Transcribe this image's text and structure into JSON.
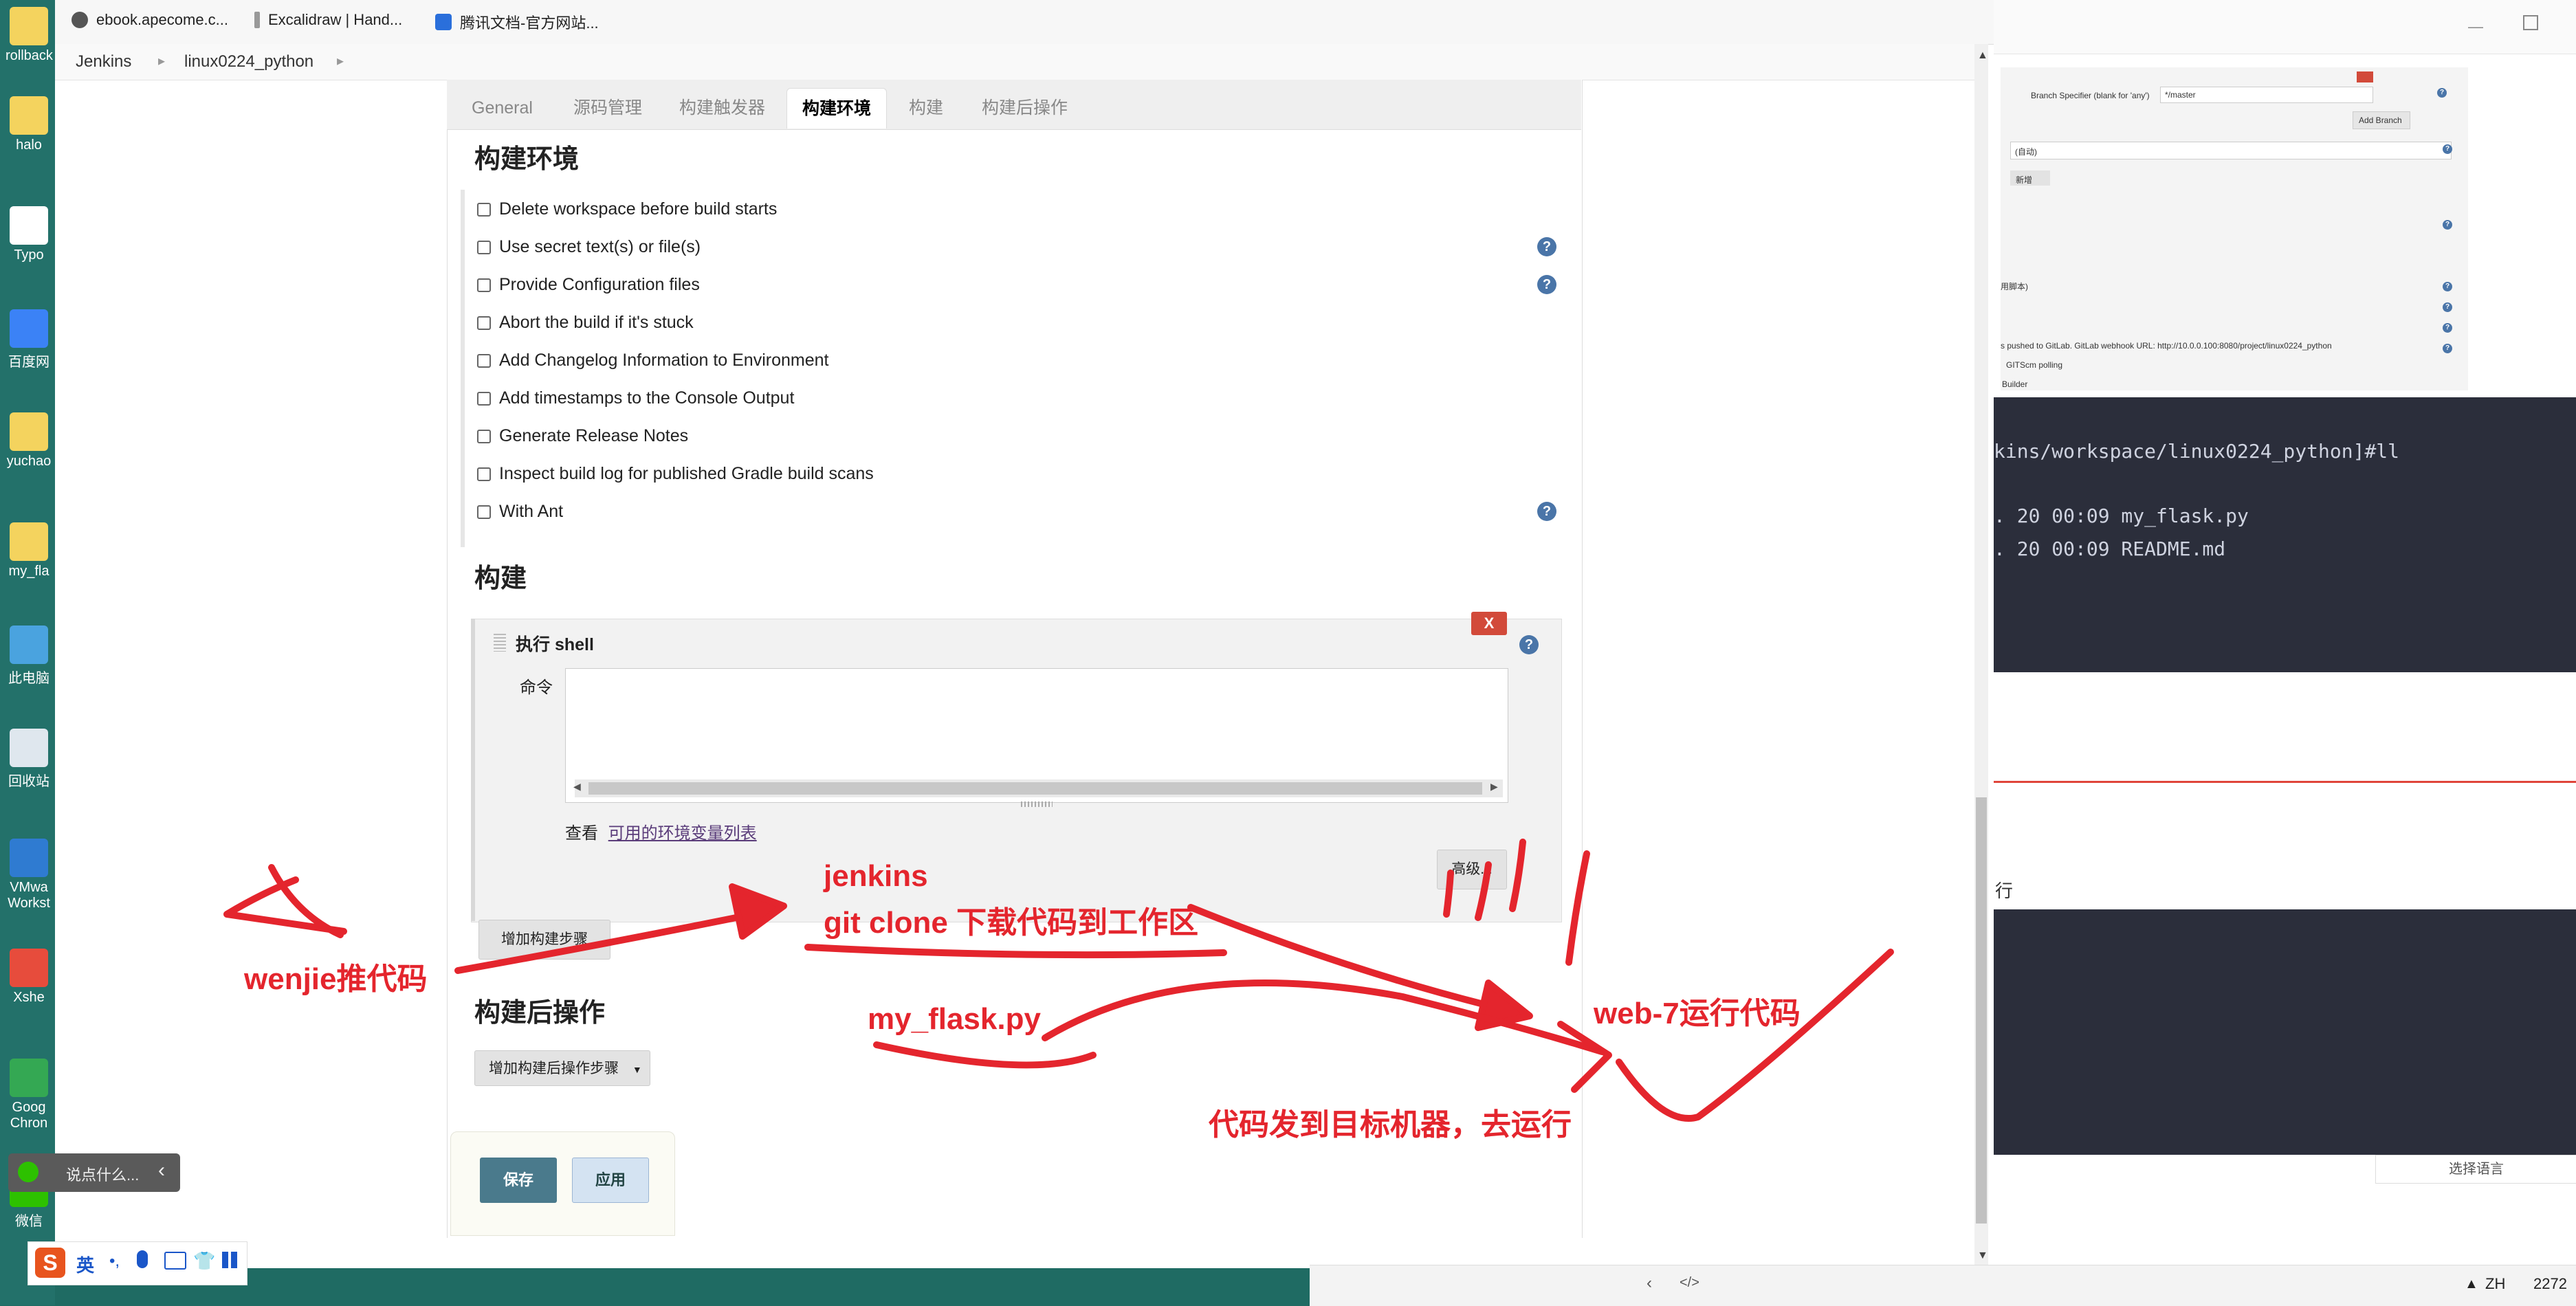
{
  "desktop": {
    "icons": [
      {
        "label": "rollback",
        "color": "#f4d35e"
      },
      {
        "label": "halo",
        "color": "#f4d35e"
      },
      {
        "label": "Typo",
        "color": "#ffffff"
      },
      {
        "label": "百度网",
        "color": "#3b82f6"
      },
      {
        "label": "yuchao",
        "color": "#f4d35e"
      },
      {
        "label": "my_fla",
        "color": "#f4d35e"
      },
      {
        "label": "此电脑",
        "color": "#4aa3df"
      },
      {
        "label": "回收站",
        "color": "#dfe7ee"
      },
      {
        "label": "VMwa Workst",
        "color": "#2f7bd1"
      },
      {
        "label": "Xshe",
        "color": "#e74c3c"
      },
      {
        "label": "Goog Chron",
        "color": "#34a853"
      },
      {
        "label": "微信",
        "color": "#2dc100"
      }
    ]
  },
  "browser": {
    "bookmarks": [
      {
        "label": "ebook.apecome.c...",
        "color": "#555555"
      },
      {
        "label": "Excalidraw | Hand...",
        "color": "#777777"
      },
      {
        "label": "腾讯文档-官方网站...",
        "color": "#2a6fdb"
      }
    ],
    "breadcrumb": [
      "Jenkins",
      "linux0224_python"
    ]
  },
  "tabs": [
    "General",
    "源码管理",
    "构建触发器",
    "构建环境",
    "构建",
    "构建后操作"
  ],
  "active_tab": "构建环境",
  "build_env": {
    "title": "构建环境",
    "options": [
      "Delete workspace before build starts",
      "Use secret text(s) or file(s)",
      "Provide Configuration files",
      "Abort the build if it's stuck",
      "Add Changelog Information to Environment",
      "Add timestamps to the Console Output",
      "Generate Release Notes",
      "Inspect build log for published Gradle build scans",
      "With Ant"
    ]
  },
  "build": {
    "title": "构建",
    "step_title": "执行 shell",
    "delete_label": "X",
    "command_label": "命令",
    "command_value": "",
    "env_prefix": "查看",
    "env_link": "可用的环境变量列表",
    "advanced_label": "高级...",
    "add_step_label": "增加构建步骤"
  },
  "post_build": {
    "title": "构建后操作",
    "add_label": "增加构建后操作步骤"
  },
  "actions": {
    "save": "保存",
    "apply": "应用"
  },
  "annotations": {
    "push": "wenjie推代码",
    "jenkins_line1": "jenkins",
    "jenkins_line2": "git clone 下载代码到工作区",
    "file": "my_flask.py",
    "run": "web-7运行代码",
    "deploy": "代码发到目标机器，去运行",
    "color": "#e4252d"
  },
  "right_windows": {
    "branch_label": "Branch Specifier (blank for 'any')",
    "branch_value": "*/master",
    "add_branch": "Add Branch",
    "auto_select": "(自动)",
    "small_btn": "新增",
    "run_script": "用脚本)",
    "gitlab_line": "s pushed to GitLab. GitLab webhook URL: http://10.0.0.100:8080/project/linux0224_python",
    "poll_line": "GITScm polling",
    "builder_line": "Builder",
    "terminal_lines": [
      "kins/workspace/linux0224_python]#ll",
      ". 20 00:09 my_flask.py",
      ". 20 00:09 README.md"
    ],
    "mid_char": "行",
    "lang_button": "选择语言"
  },
  "chat_placeholder": "说点什么...",
  "ime": {
    "mode": "英"
  },
  "tray": {
    "lang": "ZH",
    "number": "2272"
  }
}
